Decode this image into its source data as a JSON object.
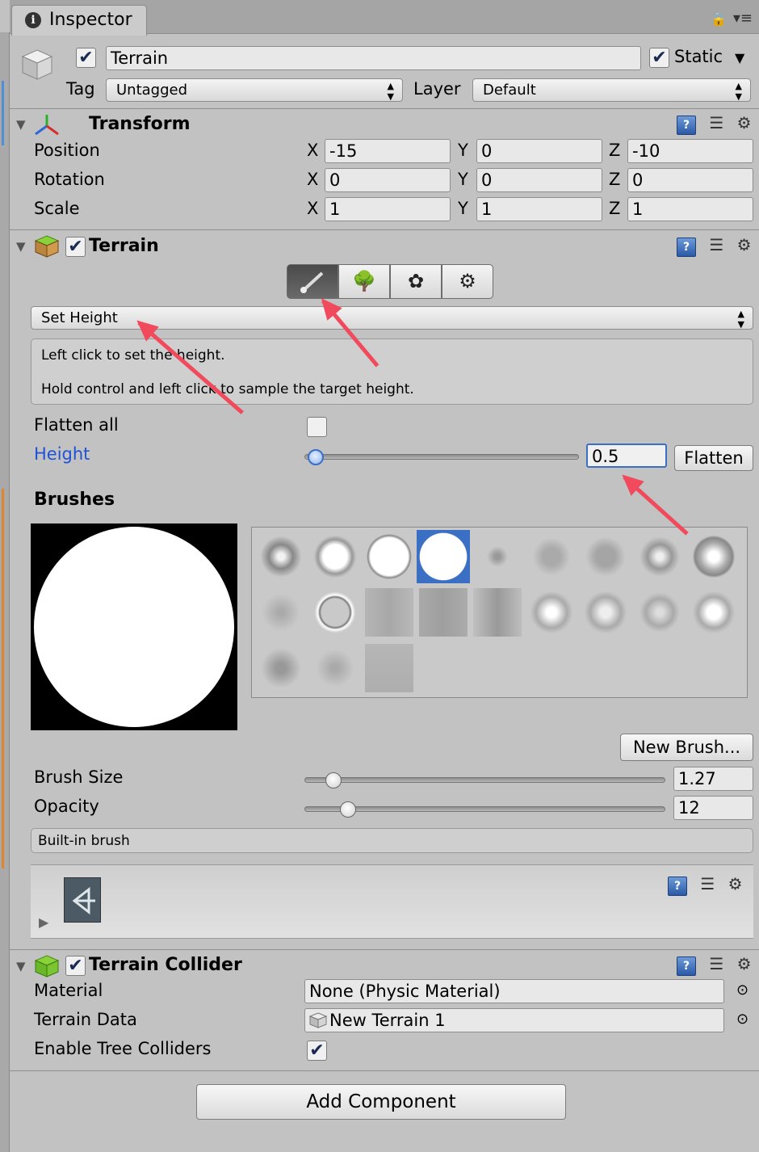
{
  "tab": {
    "title": "Inspector"
  },
  "gameobject": {
    "name": "Terrain",
    "static_label": "Static",
    "tag_label": "Tag",
    "tag_value": "Untagged",
    "layer_label": "Layer",
    "layer_value": "Default",
    "active": true,
    "static": true
  },
  "transform": {
    "title": "Transform",
    "rows": [
      {
        "label": "Position",
        "x": "-15",
        "y": "0",
        "z": "-10"
      },
      {
        "label": "Rotation",
        "x": "0",
        "y": "0",
        "z": "0"
      },
      {
        "label": "Scale",
        "x": "1",
        "y": "1",
        "z": "1"
      }
    ],
    "axis": {
      "x": "X",
      "y": "Y",
      "z": "Z"
    }
  },
  "terrain": {
    "title": "Terrain",
    "tool_dropdown": "Set Height",
    "help_line1": "Left click to set the height.",
    "help_line2": "Hold control and left click to sample the target height.",
    "flatten_all_label": "Flatten all",
    "flatten_all": false,
    "height_label": "Height",
    "height_value": "0.5",
    "height_fraction": 0.04,
    "flatten_button": "Flatten",
    "brushes_label": "Brushes",
    "new_brush_button": "New Brush...",
    "brush_size_label": "Brush Size",
    "brush_size_value": "1.27",
    "brush_size_fraction": 0.08,
    "opacity_label": "Opacity",
    "opacity_value": "12",
    "opacity_fraction": 0.12,
    "brush_name": "Built-in brush",
    "selected_brush_index": 3
  },
  "collider": {
    "title": "Terrain Collider",
    "material_label": "Material",
    "material_value": "None (Physic Material)",
    "terrain_data_label": "Terrain Data",
    "terrain_data_value": "New Terrain 1",
    "tree_colliders_label": "Enable Tree Colliders",
    "tree_colliders": true
  },
  "add_component": "Add Component",
  "colors": {
    "accent": "#3a6fc4",
    "arrow": "#f04a5c",
    "link": "#1f52d6"
  }
}
